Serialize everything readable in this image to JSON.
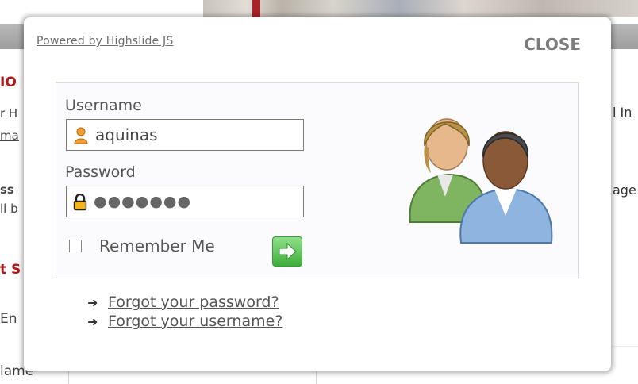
{
  "background": {
    "left_snippets": [
      "IO",
      "r H",
      "ma",
      "ss",
      "ll b",
      "t S",
      "En",
      "lame"
    ],
    "right_snippets": [
      "l In",
      "age"
    ]
  },
  "dialog": {
    "powered_by": "Powered by Highslide JS",
    "close_label": "CLOSE",
    "username_label": "Username",
    "username_value": "aquinas",
    "password_label": "Password",
    "password_masked": "●●●●●●●",
    "remember_label": "Remember Me",
    "remember_checked": false,
    "forgot_password": "Forgot your password?",
    "forgot_username": "Forgot your username?"
  },
  "icons": [
    "user-icon",
    "lock-icon",
    "go-arrow-icon",
    "users-icon",
    "arrow-right-icon"
  ],
  "colors": {
    "accent_red": "#b01a1a",
    "go_green": "#3fae3a",
    "box_border": "#d9dbe9"
  }
}
